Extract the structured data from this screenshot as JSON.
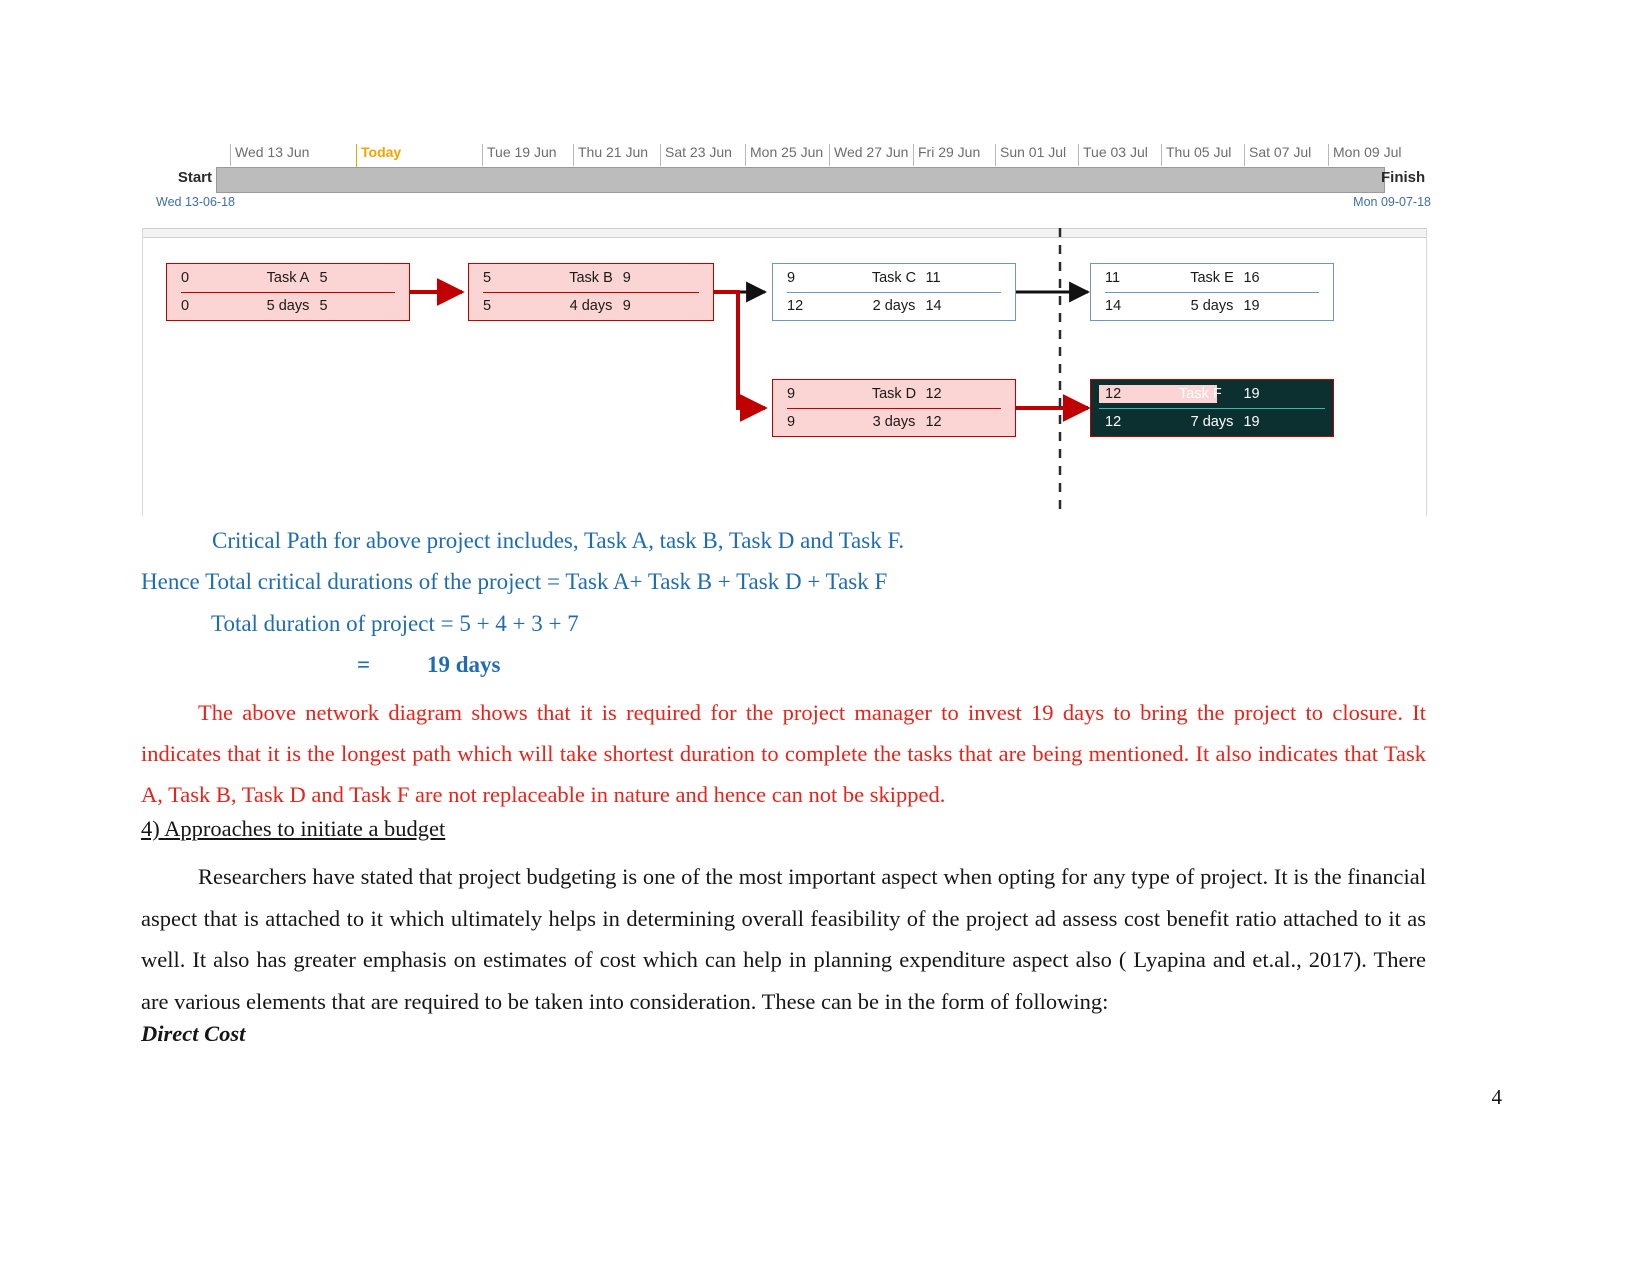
{
  "gantt": {
    "start_label": "Start",
    "finish_label": "Finish",
    "start_date": "Wed 13-06-18",
    "finish_date": "Mon 09-07-18",
    "today_label": "Today",
    "date_ticks": [
      "Wed 13 Jun",
      "Today",
      "Tue 19 Jun",
      "Thu 21 Jun",
      "Sat 23 Jun",
      "Mon 25 Jun",
      "Wed 27 Jun",
      "Fri 29 Jun",
      "Sun 01 Jul",
      "Tue 03 Jul",
      "Thu 05 Jul",
      "Sat 07 Jul",
      "Mon 09 Jul"
    ]
  },
  "network": {
    "nodes": [
      {
        "id": "task-a",
        "name": "Task A",
        "early_start": "0",
        "early_finish": "5",
        "late_start": "0",
        "late_finish": "5",
        "duration": "5 days",
        "style": "critical"
      },
      {
        "id": "task-b",
        "name": "Task B",
        "early_start": "5",
        "early_finish": "9",
        "late_start": "5",
        "late_finish": "9",
        "duration": "4 days",
        "style": "critical"
      },
      {
        "id": "task-c",
        "name": "Task C",
        "early_start": "9",
        "early_finish": "11",
        "late_start": "12",
        "late_finish": "14",
        "duration": "2 days",
        "style": "noncritical"
      },
      {
        "id": "task-e",
        "name": "Task E",
        "early_start": "11",
        "early_finish": "16",
        "late_start": "14",
        "late_finish": "19",
        "duration": "5 days",
        "style": "noncritical"
      },
      {
        "id": "task-d",
        "name": "Task D",
        "early_start": "9",
        "early_finish": "12",
        "late_start": "9",
        "late_finish": "12",
        "duration": "3 days",
        "style": "critical"
      },
      {
        "id": "task-f",
        "name": "Task F",
        "early_start": "12",
        "early_finish": "19",
        "late_start": "12",
        "late_finish": "19",
        "duration": "7 days",
        "style": "selected"
      }
    ]
  },
  "body": {
    "critical_path_line": "Critical Path for above project includes, Task A, task B, Task D and Task F.",
    "hence_line": "Hence Total critical durations of the project = Task A+ Task B + Task D + Task F",
    "total_duration_line": "Total duration of project = 5 + 4 + 3 + 7",
    "equals_sign": "=",
    "result": "19 days",
    "red_paragraph": "The above network diagram shows that it is required for the project manager to invest 19 days to bring the project to closure. It indicates that it is the longest path which will take shortest duration to complete the tasks that are being mentioned. It also indicates that Task A, Task B, Task D and Task F are not replaceable in nature and hence can not be skipped.",
    "heading": "4) Approaches to initiate a budget ",
    "black_paragraph": "Researchers have stated that project budgeting is one of the most important aspect when opting for any type of project. It is the financial aspect that is attached to it which ultimately helps in determining overall feasibility of the project ad assess cost benefit ratio attached to it as well. It also has greater emphasis on estimates of cost which can help in planning expenditure aspect also ( Lyapina and et.al., 2017). There are various elements that are required to be taken into consideration. These can be in the form of following:",
    "subheading": "Direct Cost",
    "page_number": "4"
  },
  "colors": {
    "blue_text": "#1f6cb0",
    "red_text": "#e8231a",
    "black_text": "#161616",
    "critical_fill": "#fbd4d4",
    "critical_border": "#c00000",
    "noncritical_border": "#7296c4",
    "selected_fill": "#0c2f30",
    "today_marker": "#f4a300",
    "gantt_bar": "#bcbcbc"
  }
}
